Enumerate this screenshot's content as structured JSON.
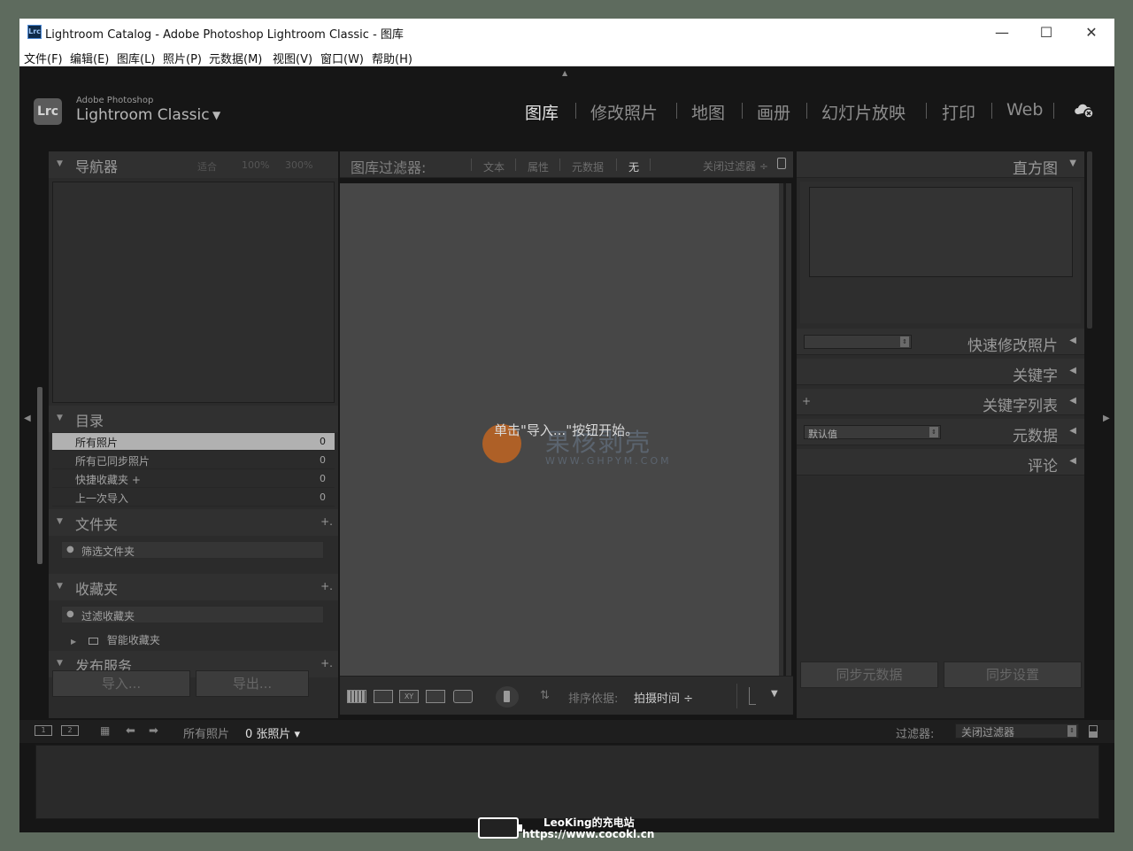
{
  "window": {
    "app_icon": "Lrc",
    "title": "Lightroom Catalog - Adobe Photoshop Lightroom Classic - 图库",
    "controls": {
      "minimize": "—",
      "maximize": "☐",
      "close": "✕"
    }
  },
  "menubar": [
    "文件(F)",
    "编辑(E)",
    "图库(L)",
    "照片(P)",
    "元数据(M)",
    "视图(V)",
    "窗口(W)",
    "帮助(H)"
  ],
  "identity": {
    "logo": "Lrc",
    "brand_small": "Adobe Photoshop",
    "brand_big": "Lightroom Classic",
    "caret": "▼"
  },
  "modules": {
    "items": [
      "图库",
      "修改照片",
      "地图",
      "画册",
      "幻灯片放映",
      "打印",
      "Web"
    ],
    "active": "图库"
  },
  "left_panel": {
    "navigator": {
      "title": "导航器",
      "tabs": [
        "适合",
        "100%",
        "300%"
      ]
    },
    "catalog": {
      "title": "目录",
      "rows": [
        {
          "label": "所有照片",
          "count": "0",
          "selected": true
        },
        {
          "label": "所有已同步照片",
          "count": "0"
        },
        {
          "label": "快捷收藏夹 +",
          "count": "0"
        },
        {
          "label": "上一次导入",
          "count": "0"
        }
      ]
    },
    "folders": {
      "title": "文件夹",
      "plus": "+.",
      "filter_placeholder": "筛选文件夹"
    },
    "collections": {
      "title": "收藏夹",
      "plus": "+.",
      "filter_placeholder": "过滤收藏夹",
      "smart": "智能收藏夹"
    },
    "publish": {
      "title": "发布服务",
      "plus": "+."
    },
    "import_button": "导入...",
    "export_button": "导出..."
  },
  "filter_bar": {
    "title": "图库过滤器:",
    "items": [
      "文本",
      "属性",
      "元数据",
      "无"
    ],
    "active": "无",
    "close_label": "关闭过滤器 ÷"
  },
  "grid": {
    "hint": "单击\"导入...\"按钮开始。",
    "watermark_text": "果核剥壳",
    "watermark_sub": "WWW.GHPYM.COM"
  },
  "toolbar": {
    "sort_label": "排序依据:",
    "sort_value": "拍摄时间 ÷"
  },
  "right_panel": {
    "histogram": "直方图",
    "quick_develop": "快速修改照片",
    "keywording": "关键字",
    "keyword_list": "关键字列表",
    "keyword_plus": "+",
    "metadata": "元数据",
    "metadata_preset": "默认值",
    "comments": "评论",
    "sync_metadata": "同步元数据",
    "sync_settings": "同步设置"
  },
  "filmstrip": {
    "source": "所有照片",
    "count": "0 张照片 ▾",
    "filter_label": "过滤器:",
    "filter_value": "关闭过滤器"
  },
  "overlay": {
    "line1": "LeoKing的充电站",
    "line2": "https://www.cocokl.cn"
  }
}
